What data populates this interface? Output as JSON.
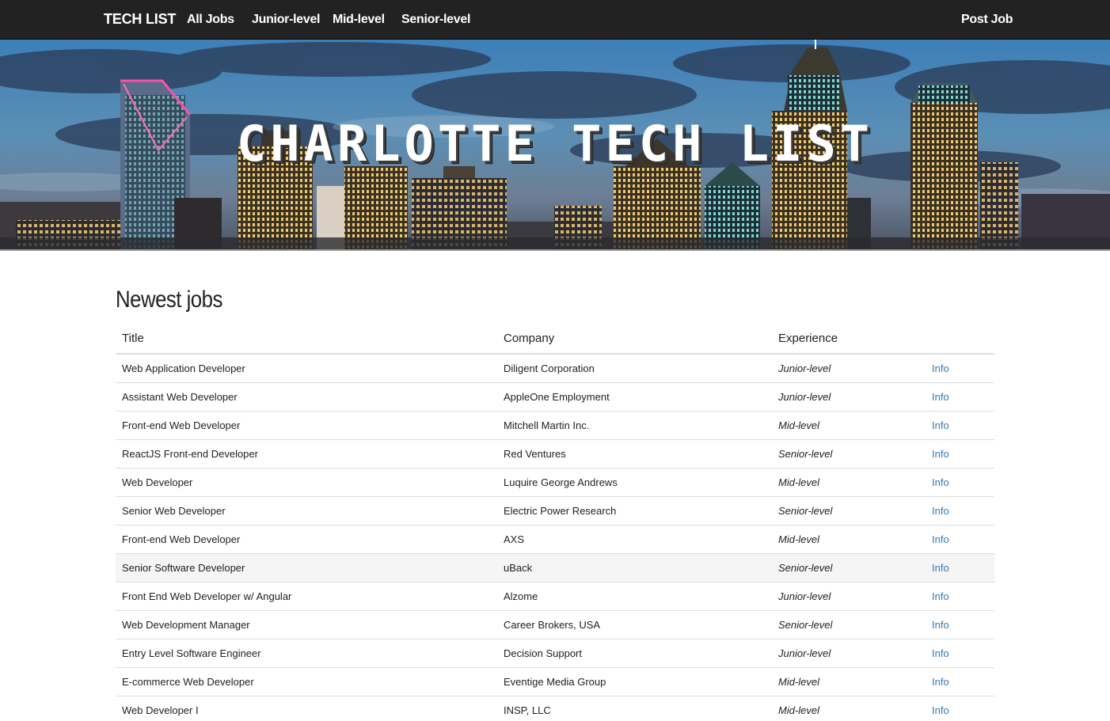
{
  "nav": {
    "brand": "TECH LIST",
    "links": [
      "All Jobs",
      "Junior-level",
      "Mid-level",
      "Senior-level"
    ],
    "post_job": "Post Job"
  },
  "hero": {
    "title": "CHARLOTTE TECH LIST"
  },
  "main": {
    "heading": "Newest jobs",
    "columns": [
      "Title",
      "Company",
      "Experience",
      ""
    ],
    "rows": [
      {
        "title": "Web Application Developer",
        "company": "Diligent Corporation",
        "experience": "Junior-level",
        "action": "Info"
      },
      {
        "title": "Assistant Web Developer",
        "company": "AppleOne Employment",
        "experience": "Junior-level",
        "action": "Info"
      },
      {
        "title": "Front-end Web Developer",
        "company": "Mitchell Martin Inc.",
        "experience": "Mid-level",
        "action": "Info"
      },
      {
        "title": "ReactJS Front-end Developer",
        "company": "Red Ventures",
        "experience": "Senior-level",
        "action": "Info"
      },
      {
        "title": "Web Developer",
        "company": "Luquire George Andrews",
        "experience": "Mid-level",
        "action": "Info"
      },
      {
        "title": "Senior Web Developer",
        "company": "Electric Power Research",
        "experience": "Senior-level",
        "action": "Info"
      },
      {
        "title": "Front-end Web Developer",
        "company": "AXS",
        "experience": "Mid-level",
        "action": "Info"
      },
      {
        "title": "Senior Software Developer",
        "company": "uBack",
        "experience": "Senior-level",
        "action": "Info"
      },
      {
        "title": "Front End Web Developer w/ Angular",
        "company": "Alzome",
        "experience": "Junior-level",
        "action": "Info"
      },
      {
        "title": "Web Development Manager",
        "company": "Career Brokers, USA",
        "experience": "Senior-level",
        "action": "Info"
      },
      {
        "title": "Entry Level Software Engineer",
        "company": "Decision Support",
        "experience": "Junior-level",
        "action": "Info"
      },
      {
        "title": "E-commerce Web Developer",
        "company": "Eventige Media Group",
        "experience": "Mid-level",
        "action": "Info"
      },
      {
        "title": "Web Developer I",
        "company": "INSP, LLC",
        "experience": "Mid-level",
        "action": "Info"
      }
    ]
  },
  "colors": {
    "navbar_bg": "#222222",
    "link_blue": "#337ab7",
    "row_hover": "#f5f5f5",
    "border": "#dddddd"
  }
}
